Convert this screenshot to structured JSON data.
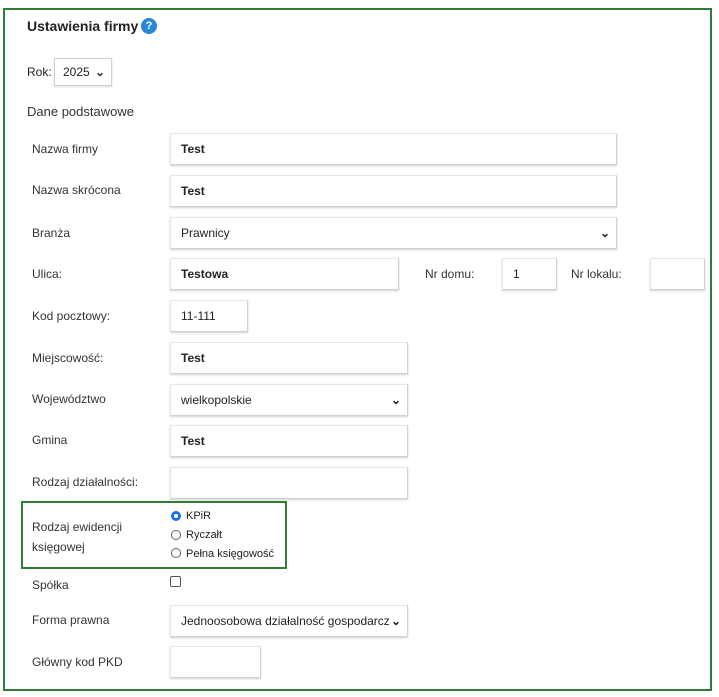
{
  "header": {
    "title": "Ustawienia firmy",
    "help_icon": "?"
  },
  "year": {
    "label": "Rok:",
    "value": "2025"
  },
  "section_title": "Dane podstawowe",
  "fields": {
    "company_name": {
      "label": "Nazwa firmy",
      "value": "Test"
    },
    "short_name": {
      "label": "Nazwa skrócona",
      "value": "Test"
    },
    "industry": {
      "label": "Branża",
      "value": "Prawnicy"
    },
    "street": {
      "label": "Ulica:",
      "value": "Testowa"
    },
    "house_no": {
      "label": "Nr domu:",
      "value": "1"
    },
    "apartment_no": {
      "label": "Nr lokalu:",
      "value": ""
    },
    "postal_code": {
      "label": "Kod pocztowy:",
      "value": "11-111"
    },
    "city": {
      "label": "Miejscowość:",
      "value": "Test"
    },
    "voivodeship": {
      "label": "Województwo",
      "value": "wielkopolskie"
    },
    "commune": {
      "label": "Gmina",
      "value": "Test"
    },
    "activity_type": {
      "label": "Rodzaj działalności:",
      "value": ""
    },
    "accounting_type": {
      "label_line1": "Rodzaj ewidencji",
      "label_line2": "księgowej",
      "options": [
        "KPiR",
        "Ryczałt",
        "Pełna księgowość"
      ],
      "selected": "KPiR"
    },
    "partnership": {
      "label": "Spółka",
      "checked": false
    },
    "legal_form": {
      "label": "Forma prawna",
      "value": "Jednoosobowa działalność gospodarcza"
    },
    "pkd": {
      "label": "Główny kod PKD",
      "value": ""
    }
  },
  "colors": {
    "frame": "#2e7d32",
    "accent": "#1a73e8",
    "help": "#2a86d6"
  }
}
